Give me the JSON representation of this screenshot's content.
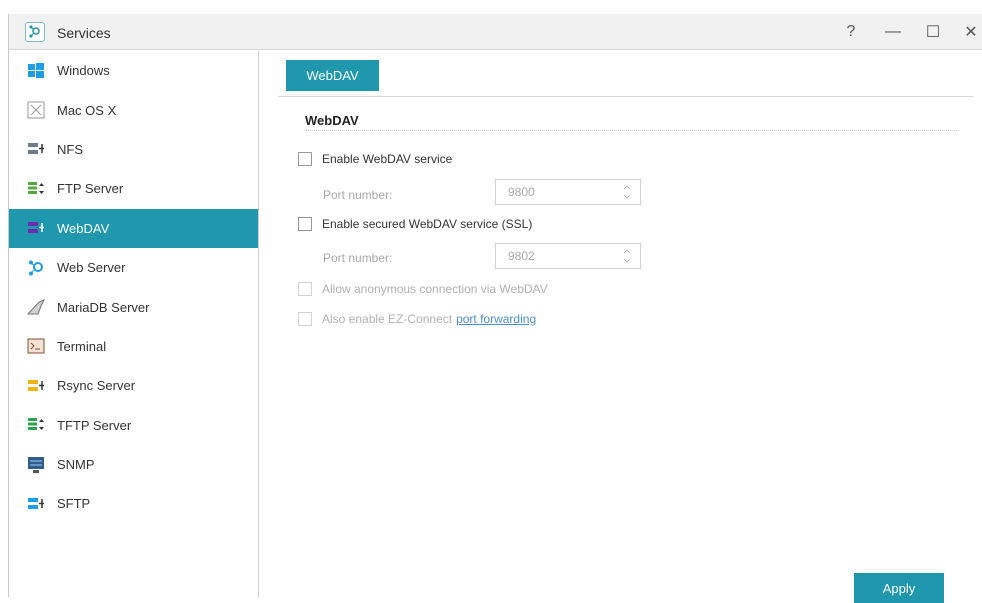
{
  "window": {
    "title": "Services",
    "controls": {
      "help": "?",
      "minimize": "—",
      "maximize": "☐",
      "close": "✕"
    }
  },
  "sidebar": {
    "items": [
      {
        "label": "Windows",
        "icon": "windows-icon",
        "active": false
      },
      {
        "label": "Mac OS X",
        "icon": "macos-icon",
        "active": false
      },
      {
        "label": "NFS",
        "icon": "nfs-icon",
        "active": false
      },
      {
        "label": "FTP Server",
        "icon": "ftp-icon",
        "active": false
      },
      {
        "label": "WebDAV",
        "icon": "webdav-icon",
        "active": true
      },
      {
        "label": "Web Server",
        "icon": "web-server-icon",
        "active": false
      },
      {
        "label": "MariaDB Server",
        "icon": "mariadb-icon",
        "active": false
      },
      {
        "label": "Terminal",
        "icon": "terminal-icon",
        "active": false
      },
      {
        "label": "Rsync Server",
        "icon": "rsync-icon",
        "active": false
      },
      {
        "label": "TFTP Server",
        "icon": "tftp-icon",
        "active": false
      },
      {
        "label": "SNMP",
        "icon": "snmp-icon",
        "active": false
      },
      {
        "label": "SFTP",
        "icon": "sftp-icon",
        "active": false
      }
    ]
  },
  "main": {
    "tab_label": "WebDAV",
    "section_title": "WebDAV",
    "enable_webdav": {
      "label": "Enable WebDAV service",
      "checked": false
    },
    "port1": {
      "label": "Port number:",
      "value": "9800"
    },
    "enable_ssl": {
      "label": "Enable secured WebDAV service (SSL)",
      "checked": false
    },
    "port2": {
      "label": "Port number:",
      "value": "9802"
    },
    "anonymous": {
      "label": "Allow anonymous connection via WebDAV",
      "checked": false,
      "disabled": true
    },
    "ezconnect": {
      "label": "Also enable EZ-Connect",
      "link": "port forwarding",
      "checked": false,
      "disabled": true
    },
    "apply_label": "Apply"
  },
  "colors": {
    "accent": "#1f97ad",
    "link": "#4b8fd1"
  }
}
